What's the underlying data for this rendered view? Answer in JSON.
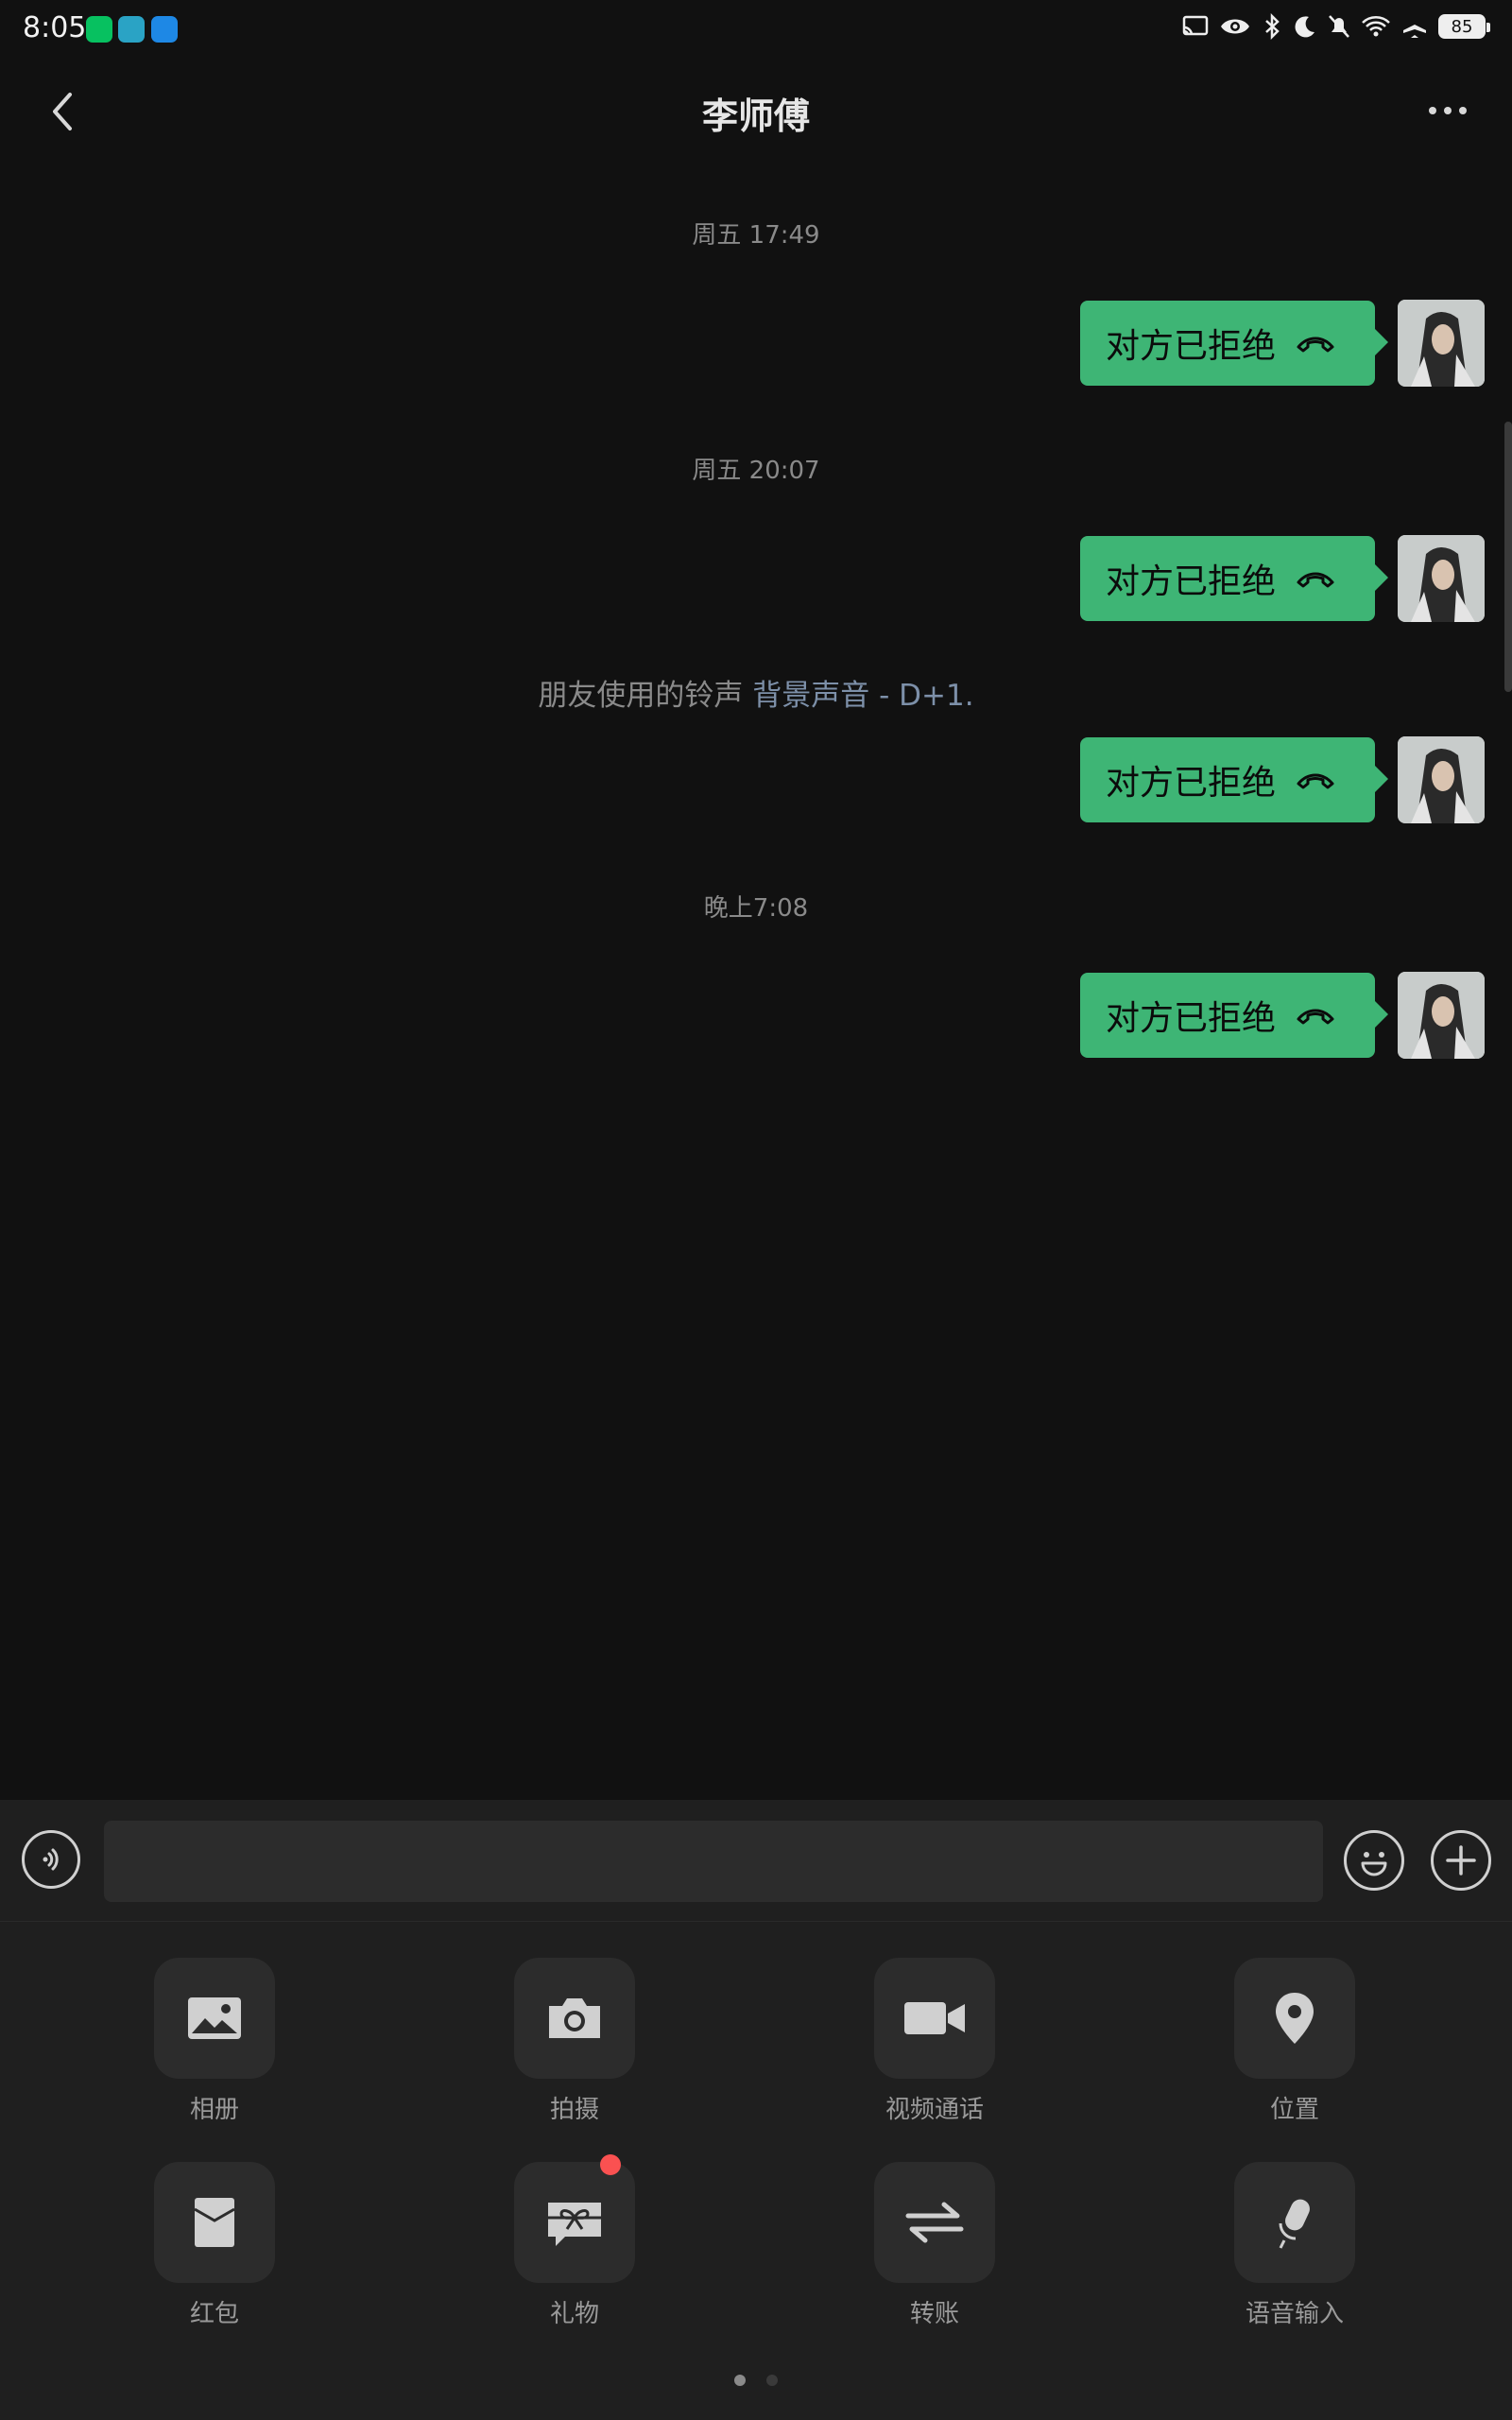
{
  "status_bar": {
    "time": "8:05",
    "battery": "85"
  },
  "header": {
    "title": "李师傅"
  },
  "messages": [
    {
      "timestamp": "周五 17:49",
      "text": "对方已拒绝"
    },
    {
      "timestamp": "周五 20:07",
      "text": "对方已拒绝"
    },
    {
      "system_prefix": "朋友使用的铃声",
      "system_link": "背景声音 - D+1.",
      "text": "对方已拒绝"
    },
    {
      "timestamp": "晚上7:08",
      "text": "对方已拒绝"
    }
  ],
  "input": {
    "value": "",
    "placeholder": ""
  },
  "tools": [
    {
      "label": "相册",
      "icon": "photo-album-icon"
    },
    {
      "label": "拍摄",
      "icon": "camera-icon"
    },
    {
      "label": "视频通话",
      "icon": "video-call-icon"
    },
    {
      "label": "位置",
      "icon": "location-pin-icon"
    },
    {
      "label": "红包",
      "icon": "red-packet-icon"
    },
    {
      "label": "礼物",
      "icon": "gift-icon"
    },
    {
      "label": "转账",
      "icon": "transfer-icon"
    },
    {
      "label": "语音输入",
      "icon": "voice-input-icon"
    }
  ],
  "colors": {
    "bubble": "#3eb575",
    "background": "#111111",
    "panel": "#1f1f1f",
    "badge": "#fa5151"
  }
}
